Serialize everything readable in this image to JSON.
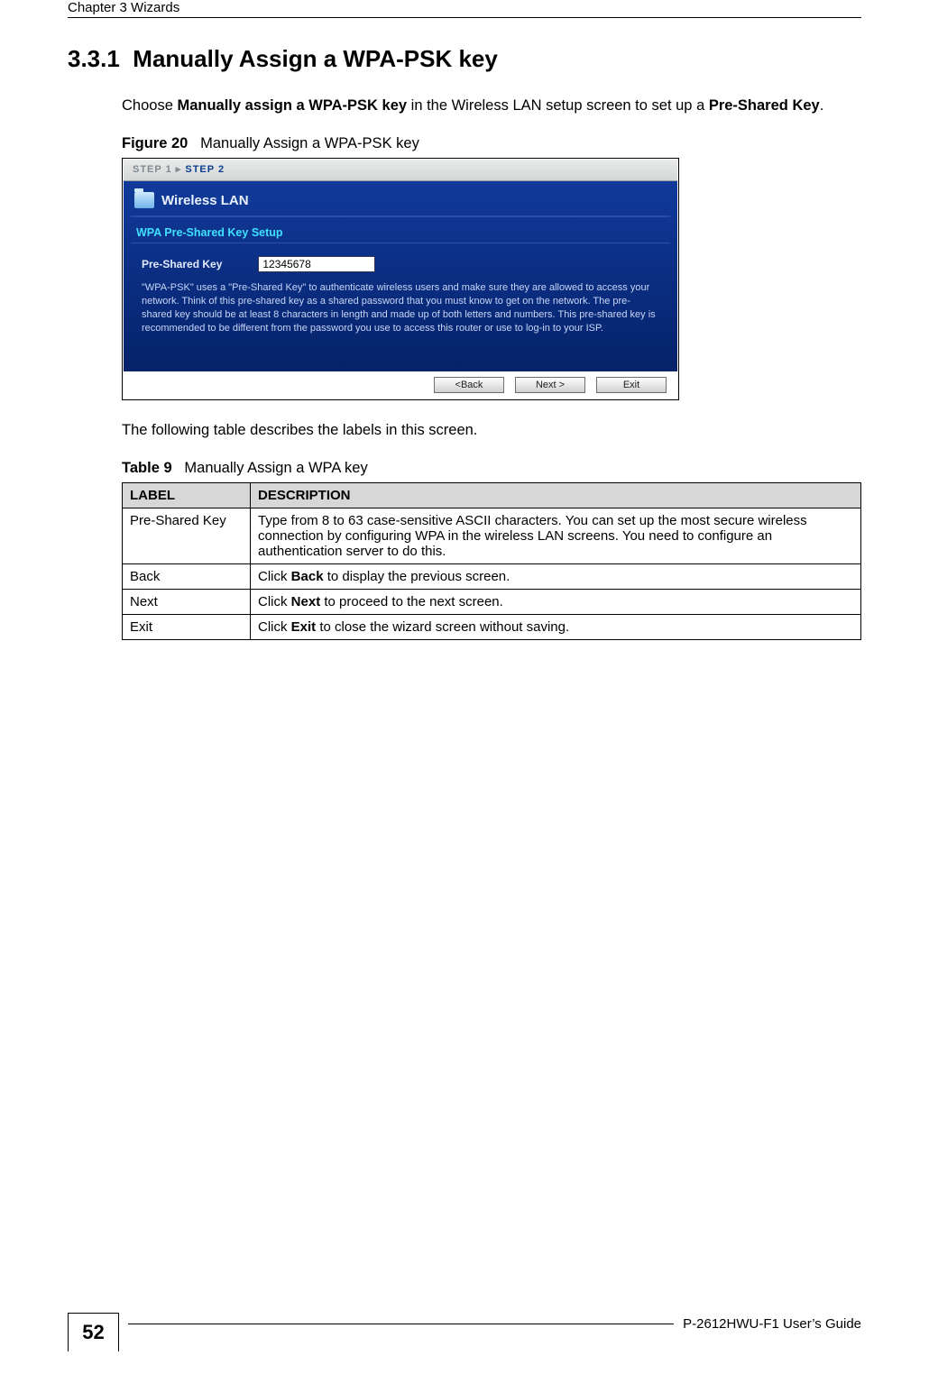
{
  "header": {
    "chapter": "Chapter 3 Wizards"
  },
  "section": {
    "number": "3.3.1",
    "title": "Manually Assign a WPA-PSK key"
  },
  "para1_pre": "Choose ",
  "para1_bold1": "Manually assign a WPA-PSK key",
  "para1_mid": " in the Wireless LAN setup screen to set up a ",
  "para1_bold2": "Pre-Shared Key",
  "para1_end": ".",
  "figure": {
    "label": "Figure 20",
    "caption": "Manually Assign a WPA-PSK key"
  },
  "wizard": {
    "step1": "STEP 1",
    "arrow": "▸",
    "step2": "STEP 2",
    "panelTitle": "Wireless LAN",
    "subHeading": "WPA Pre-Shared Key Setup",
    "fieldLabel": "Pre-Shared Key",
    "fieldValue": "12345678",
    "helpText": "\"WPA-PSK\" uses a \"Pre-Shared Key\" to authenticate wireless users and make sure they are allowed to access your network. Think of this pre-shared key as a shared password that you must know to get on the network. The pre-shared key should be at least 8 characters in length and made up of both letters and numbers. This pre-shared key is recommended to be different from the password you use to access this router or use to log-in to your ISP.",
    "btnBack": "<Back",
    "btnNext": "Next >",
    "btnExit": "Exit"
  },
  "postFigure": "The following table describes the labels in this screen.",
  "table": {
    "label": "Table 9",
    "caption": "Manually Assign a WPA key",
    "hLabel": "LABEL",
    "hDesc": "DESCRIPTION",
    "r1c1": "Pre-Shared Key",
    "r1c2": "Type from 8 to 63 case-sensitive ASCII characters. You can set up the most secure wireless connection by configuring WPA in the wireless LAN screens. You need to configure an authentication server to do this.",
    "r2c1": "Back",
    "r2c2a": "Click ",
    "r2c2b": "Back",
    "r2c2c": " to display the previous screen.",
    "r3c1": "Next",
    "r3c2a": "Click ",
    "r3c2b": "Next",
    "r3c2c": " to proceed to the next screen.",
    "r4c1": "Exit",
    "r4c2a": "Click ",
    "r4c2b": "Exit",
    "r4c2c": " to close the wizard screen without saving."
  },
  "footer": {
    "pageNum": "52",
    "guide": "P-2612HWU-F1 User’s Guide"
  }
}
